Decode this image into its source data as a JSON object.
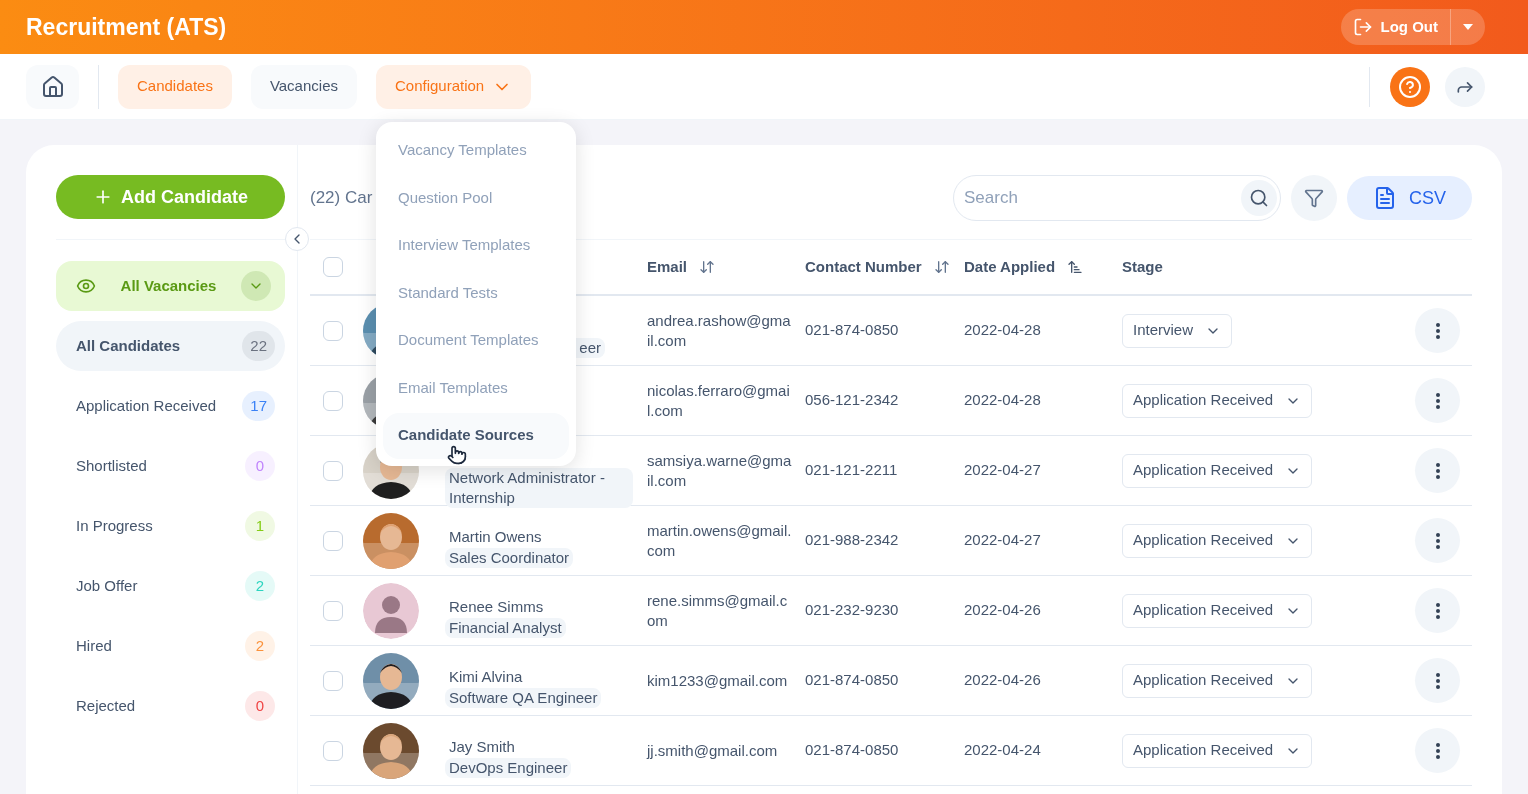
{
  "app_title": "Recruitment (ATS)",
  "logout": {
    "label": "Log Out"
  },
  "nav": [
    {
      "label": "Candidates",
      "selected": true,
      "kind": "tab"
    },
    {
      "label": "Vacancies",
      "selected": false,
      "kind": "tab"
    },
    {
      "label": "Configuration",
      "kind": "menu",
      "expanded": true
    }
  ],
  "config_menu": [
    {
      "label": "Vacancy Templates",
      "selected": false
    },
    {
      "label": "Question Pool",
      "selected": false
    },
    {
      "label": "Interview Templates",
      "selected": false
    },
    {
      "label": "Standard Tests",
      "selected": false
    },
    {
      "label": "Document Templates",
      "selected": false
    },
    {
      "label": "Email Templates",
      "selected": false
    },
    {
      "label": "Candidate Sources",
      "selected": true
    }
  ],
  "add_button": "Add Candidate",
  "vacancy_filter": "All Vacancies",
  "stages": [
    {
      "label": "All Candidates",
      "count": "22",
      "color": "#6b7280",
      "selected": true
    },
    {
      "label": "Application Received",
      "count": "17",
      "color": "#3b82f6",
      "selected": false
    },
    {
      "label": "Shortlisted",
      "count": "0",
      "color": "#c084fc",
      "selected": false
    },
    {
      "label": "In Progress",
      "count": "1",
      "color": "#84cc16",
      "selected": false
    },
    {
      "label": "Job Offer",
      "count": "2",
      "color": "#2dd4bf",
      "selected": false
    },
    {
      "label": "Hired",
      "count": "2",
      "color": "#fb923c",
      "selected": false
    },
    {
      "label": "Rejected",
      "count": "0",
      "color": "#ef4444",
      "selected": false
    }
  ],
  "list_title": "(22) Car",
  "search": {
    "placeholder": "Search"
  },
  "csv_button": "CSV",
  "header_checkbox": {
    "checked": false
  },
  "columns": [
    {
      "label": "Email",
      "kind": "sortable"
    },
    {
      "label": "Contact Number",
      "kind": "sortable"
    },
    {
      "label": "Date Applied",
      "kind": "sorted"
    },
    {
      "label": "Stage",
      "kind": "plain"
    }
  ],
  "rows": [
    {
      "job": "eer",
      "email": "andrea.rashow@gmail.com",
      "phone": "021-874-0850",
      "date": "2022-04-28",
      "stage": "Interview",
      "checked": false
    },
    {
      "email": "nicolas.ferraro@gmail.com",
      "phone": "056-121-2342",
      "date": "2022-04-28",
      "stage": "Application Received",
      "checked": false
    },
    {
      "job": "Network Administrator - Internship",
      "email": "samsiya.warne@gmail.com",
      "phone": "021-121-2211",
      "date": "2022-04-27",
      "stage": "Application Received",
      "checked": false
    },
    {
      "name": "Martin Owens",
      "job": "Sales Coordinator",
      "email": "martin.owens@gmail.com",
      "phone": "021-988-2342",
      "date": "2022-04-27",
      "stage": "Application Received",
      "checked": false
    },
    {
      "name": "Renee Simms",
      "job": "Financial Analyst",
      "email": "rene.simms@gmail.com",
      "phone": "021-232-9230",
      "date": "2022-04-26",
      "stage": "Application Received",
      "checked": false,
      "avatar": {
        "kind": "silhouette"
      }
    },
    {
      "name": "Kimi Alvina",
      "job": "Software QA Engineer",
      "email": "kim1233@gmail.com",
      "phone": "021-874-0850",
      "date": "2022-04-26",
      "stage": "Application Received",
      "checked": false
    },
    {
      "name": "Jay Smith",
      "job": "DevOps Engineer",
      "email": "jj.smith@gmail.com",
      "phone": "021-874-0850",
      "date": "2022-04-24",
      "stage": "Application Received",
      "checked": false
    }
  ]
}
